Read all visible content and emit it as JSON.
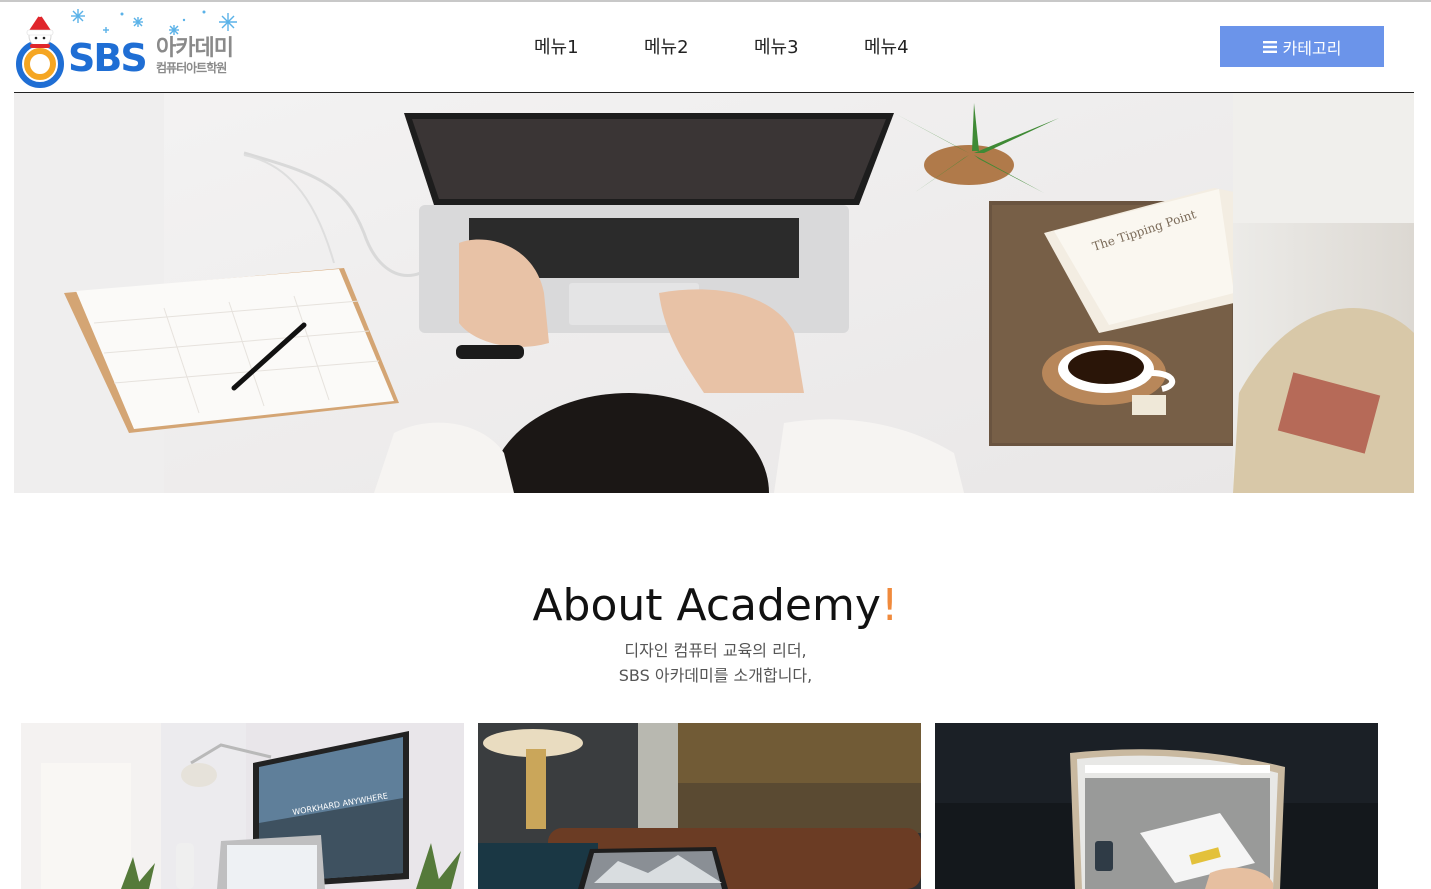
{
  "header": {
    "logo": {
      "brand": "SBS",
      "name": "아카데미",
      "subtitle": "컴퓨터아트학원"
    },
    "nav": [
      "메뉴1",
      "메뉴2",
      "메뉴3",
      "메뉴4"
    ],
    "category_button": {
      "icon": "hamburger-icon",
      "label": "카테고리",
      "color": "#6b94ea"
    }
  },
  "about": {
    "title": "About Academy",
    "title_mark": "!",
    "title_mark_color": "#f08a3c",
    "desc_line1": "디자인 컴퓨터 교육의 리더,",
    "desc_line2": "SBS 아카데미를 소개합니다,"
  },
  "hero_image": {
    "book_title": "The Tipping Point"
  },
  "cards": [
    {
      "image": "workspace-photo",
      "screen_text": "WORKHARD ANYWHERE"
    },
    {
      "image": "laptop-lounge-photo"
    },
    {
      "image": "curved-monitor-photo"
    }
  ]
}
